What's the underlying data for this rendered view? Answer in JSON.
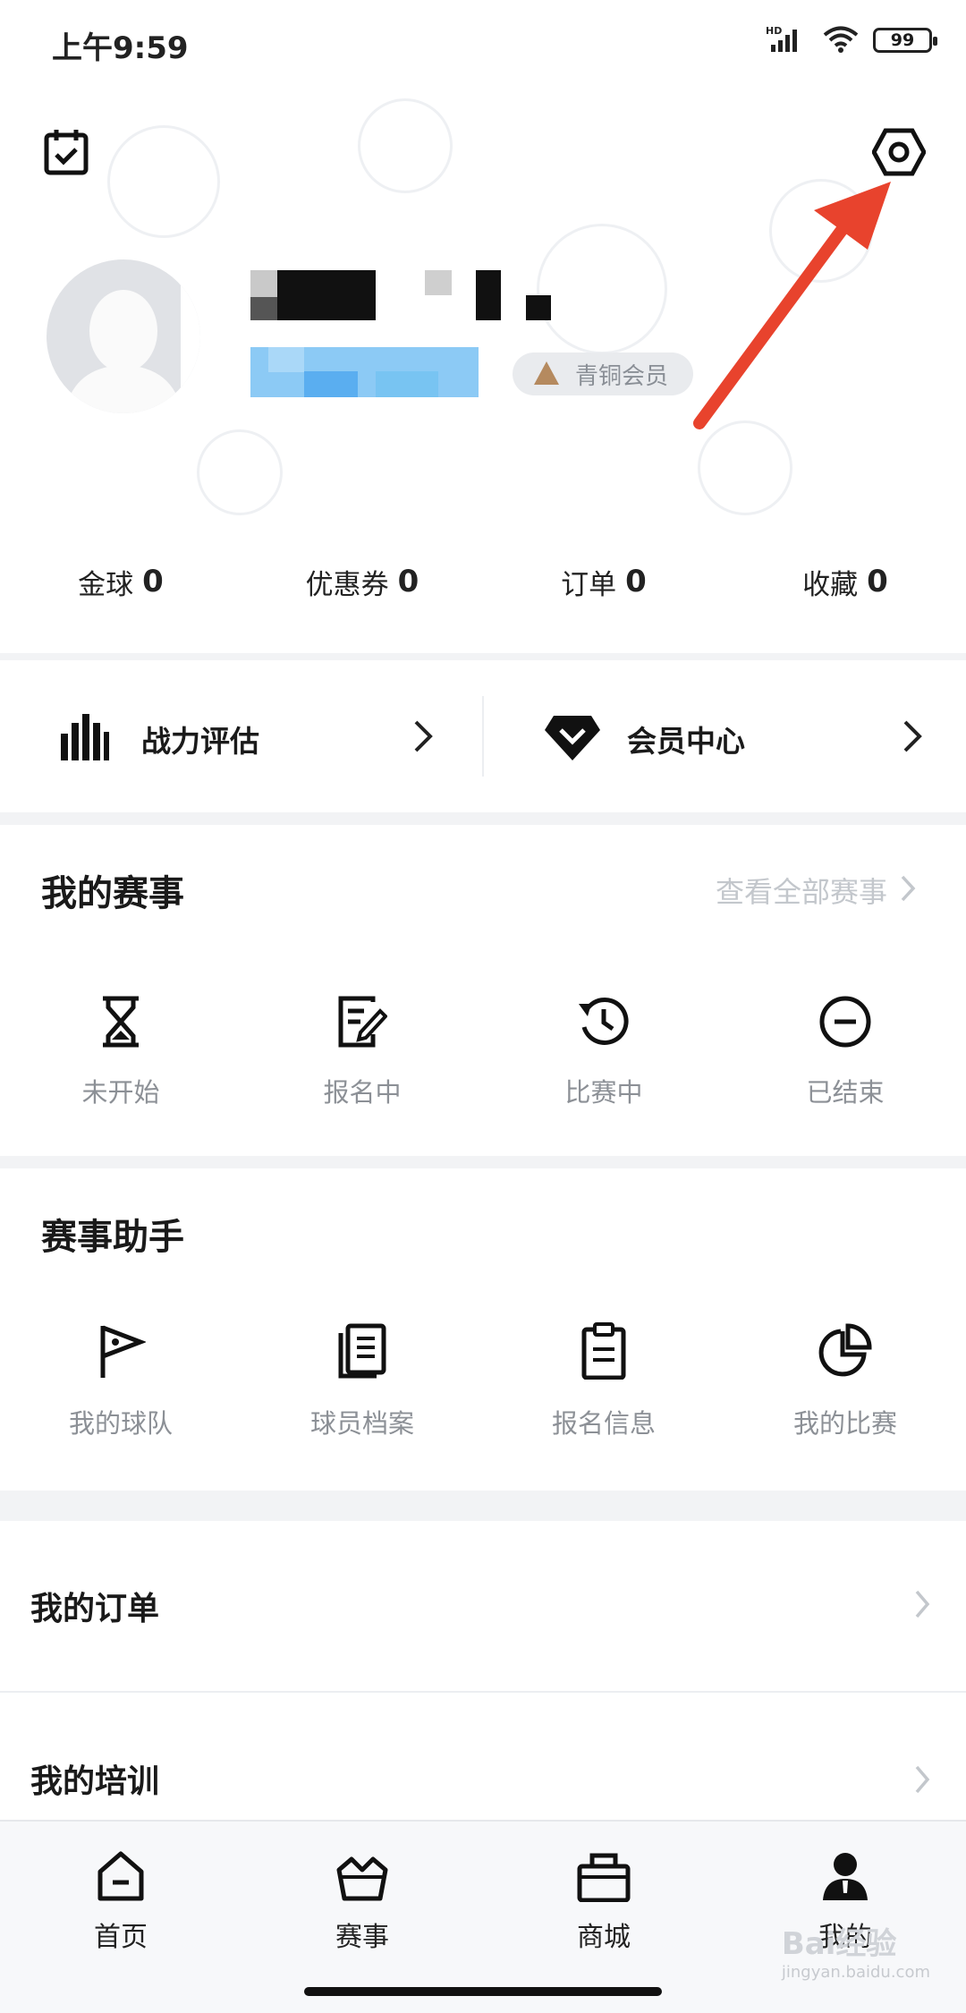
{
  "status_bar": {
    "time": "上午9:59",
    "network": "HD",
    "battery": "99"
  },
  "profile": {
    "member_badge": "青铜会员"
  },
  "stats": [
    {
      "label": "金球",
      "value": "0"
    },
    {
      "label": "优惠券",
      "value": "0"
    },
    {
      "label": "订单",
      "value": "0"
    },
    {
      "label": "收藏",
      "value": "0"
    }
  ],
  "quick_links": {
    "power_label": "战力评估",
    "member_label": "会员中心"
  },
  "my_events": {
    "title": "我的赛事",
    "view_all": "查看全部赛事",
    "items": [
      {
        "label": "未开始",
        "icon": "hourglass-icon"
      },
      {
        "label": "报名中",
        "icon": "edit-note-icon"
      },
      {
        "label": "比赛中",
        "icon": "history-clock-icon"
      },
      {
        "label": "已结束",
        "icon": "minus-circle-icon"
      }
    ]
  },
  "assistant": {
    "title": "赛事助手",
    "items": [
      {
        "label": "我的球队",
        "icon": "flag-icon"
      },
      {
        "label": "球员档案",
        "icon": "archive-icon"
      },
      {
        "label": "报名信息",
        "icon": "clipboard-icon"
      },
      {
        "label": "我的比赛",
        "icon": "pie-chart-icon"
      }
    ]
  },
  "list": {
    "orders": "我的订单",
    "training": "我的培训"
  },
  "tabbar": [
    {
      "label": "首页",
      "icon": "home-icon"
    },
    {
      "label": "赛事",
      "icon": "crown-basket-icon"
    },
    {
      "label": "商城",
      "icon": "shopping-bag-icon"
    },
    {
      "label": "我的",
      "icon": "user-icon"
    }
  ],
  "watermark": {
    "text": "Bai经验",
    "sub": "jingyan.baidu.com"
  },
  "colors": {
    "accent_arrow": "#e8432d",
    "text_muted": "#8c9096",
    "link_muted": "#c3c7cc"
  }
}
